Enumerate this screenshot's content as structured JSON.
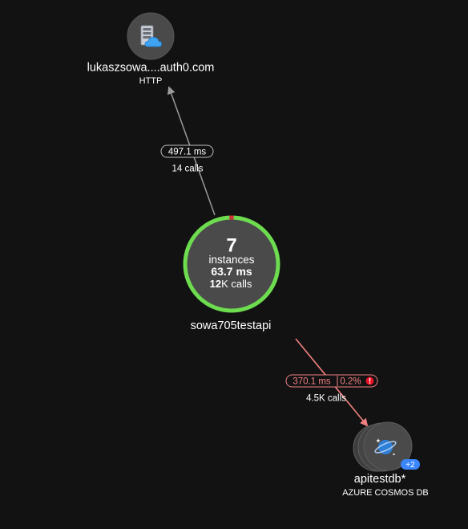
{
  "colors": {
    "background": "#121212",
    "node_fill": "#4a4a4a",
    "healthy_ring": "#6ddc4f",
    "error_ring": "#d13438",
    "failure_edge": "#f08080",
    "normal_edge": "#9a9a9a",
    "error_badge": "#e81123",
    "count_badge": "#3a86ff"
  },
  "nodes": {
    "auth0": {
      "name": "lukaszsowa....auth0.com",
      "type": "HTTP",
      "icon": "cloud-server-icon"
    },
    "app": {
      "count": "7",
      "count_label": "instances",
      "duration_value": "63.7",
      "duration_unit": " ms",
      "calls_value": "12",
      "calls_unit": "K calls",
      "name": "sowa705testapi",
      "error_fraction": 0.015
    },
    "cosmos": {
      "name": "apitestdb*",
      "type": "AZURE COSMOS DB",
      "badge": "+2",
      "icon": "planet-icon"
    }
  },
  "edges": {
    "to_auth0": {
      "duration": "497.1 ms",
      "calls": "14 calls"
    },
    "to_cosmos": {
      "duration": "370.1 ms",
      "failure_rate": "0.2%",
      "alert_icon": "exclamation-icon",
      "calls": "4.5K calls"
    }
  }
}
